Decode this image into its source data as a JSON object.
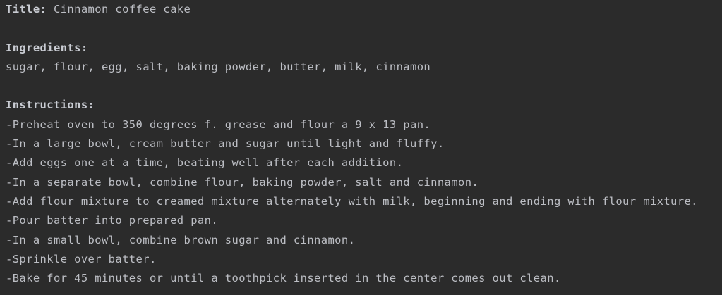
{
  "output": {
    "title_label": "Title:",
    "title_value": "Cinnamon coffee cake",
    "ingredients_label": "Ingredients:",
    "ingredients_value": "sugar, flour, egg, salt, baking_powder, butter, milk, cinnamon",
    "instructions_label": "Instructions:",
    "instructions": [
      "-Preheat oven to 350 degrees f. grease and flour a 9 x 13 pan.",
      "-In a large bowl, cream butter and sugar until light and fluffy.",
      "-Add eggs one at a time, beating well after each addition.",
      "-In a separate bowl, combine flour, baking powder, salt and cinnamon.",
      "-Add flour mixture to creamed mixture alternately with milk, beginning and ending with flour mixture.",
      "-Pour batter into prepared pan.",
      "-In a small bowl, combine brown sugar and cinnamon.",
      "-Sprinkle over batter.",
      "-Bake for 45 minutes or until a toothpick inserted in the center comes out clean."
    ]
  }
}
